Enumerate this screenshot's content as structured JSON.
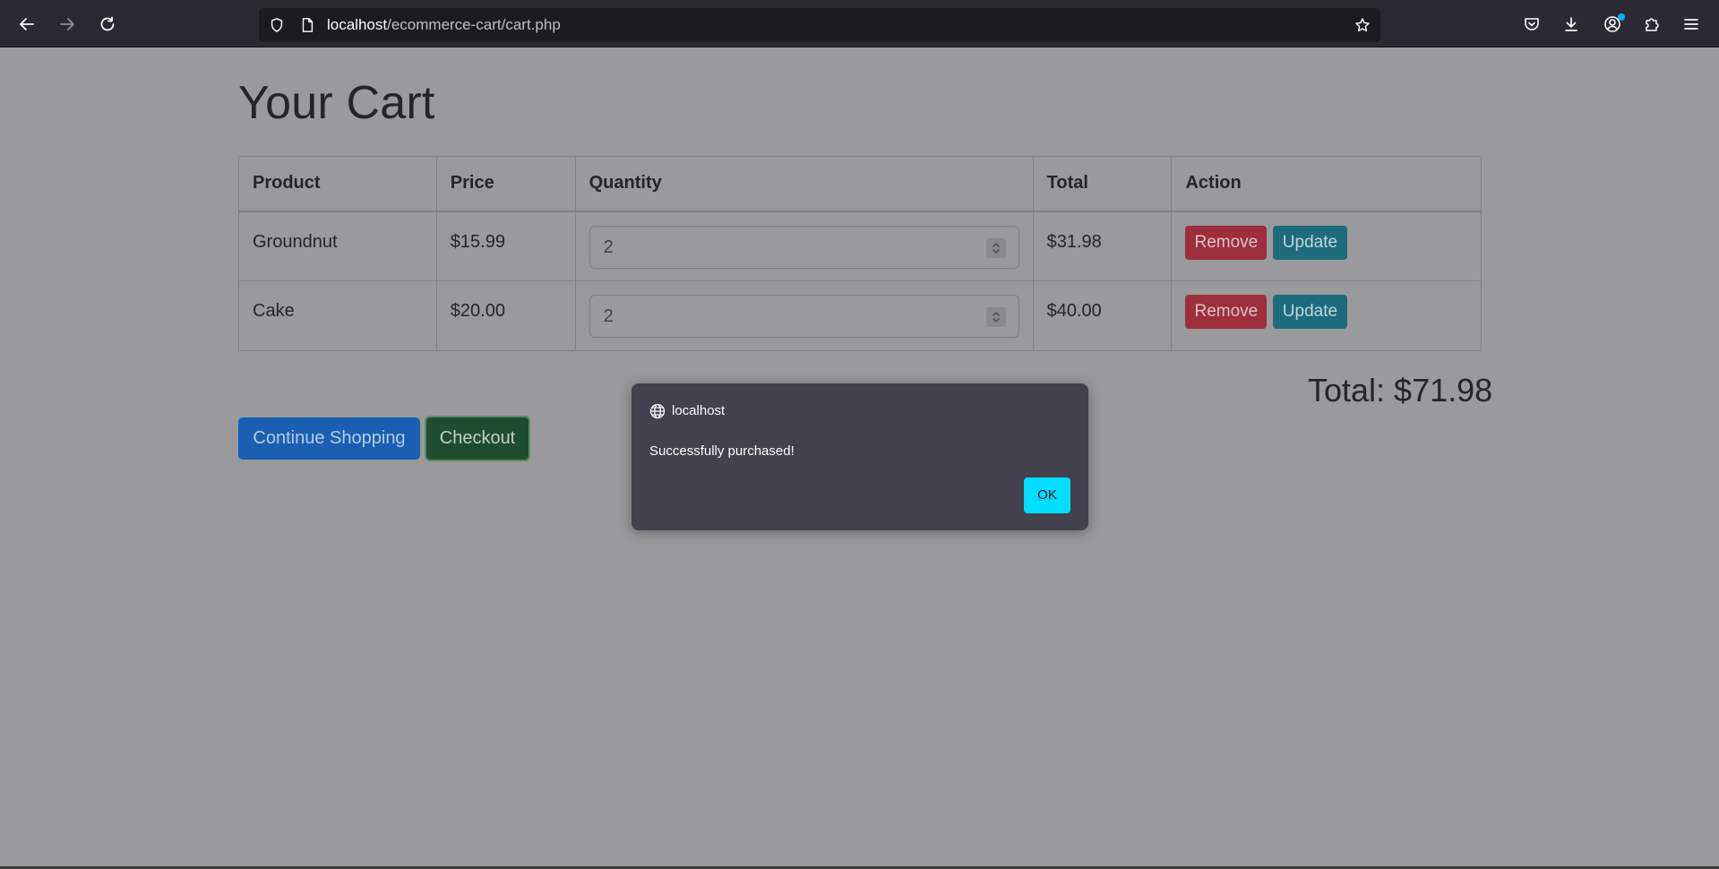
{
  "browser": {
    "url_host": "localhost",
    "url_path": "/ecommerce-cart/cart.php"
  },
  "page": {
    "title": "Your Cart",
    "table": {
      "headers": [
        "Product",
        "Price",
        "Quantity",
        "Total",
        "Action"
      ],
      "rows": [
        {
          "product": "Groundnut",
          "price": "$15.99",
          "quantity": "2",
          "total": "$31.98",
          "remove": "Remove",
          "update": "Update"
        },
        {
          "product": "Cake",
          "price": "$20.00",
          "quantity": "2",
          "total": "$40.00",
          "remove": "Remove",
          "update": "Update"
        }
      ]
    },
    "grand_total": "Total: $71.98",
    "continue_label": "Continue Shopping",
    "checkout_label": "Checkout"
  },
  "dialog": {
    "origin": "localhost",
    "message": "Successfully purchased!",
    "ok_label": "OK"
  },
  "colors": {
    "dialog_ok": "#00ddff",
    "remove_button": "#9d2e3b",
    "update_button": "#1d6b7c",
    "continue_button": "#1a5fb4",
    "checkout_button": "#1f4d2d"
  }
}
